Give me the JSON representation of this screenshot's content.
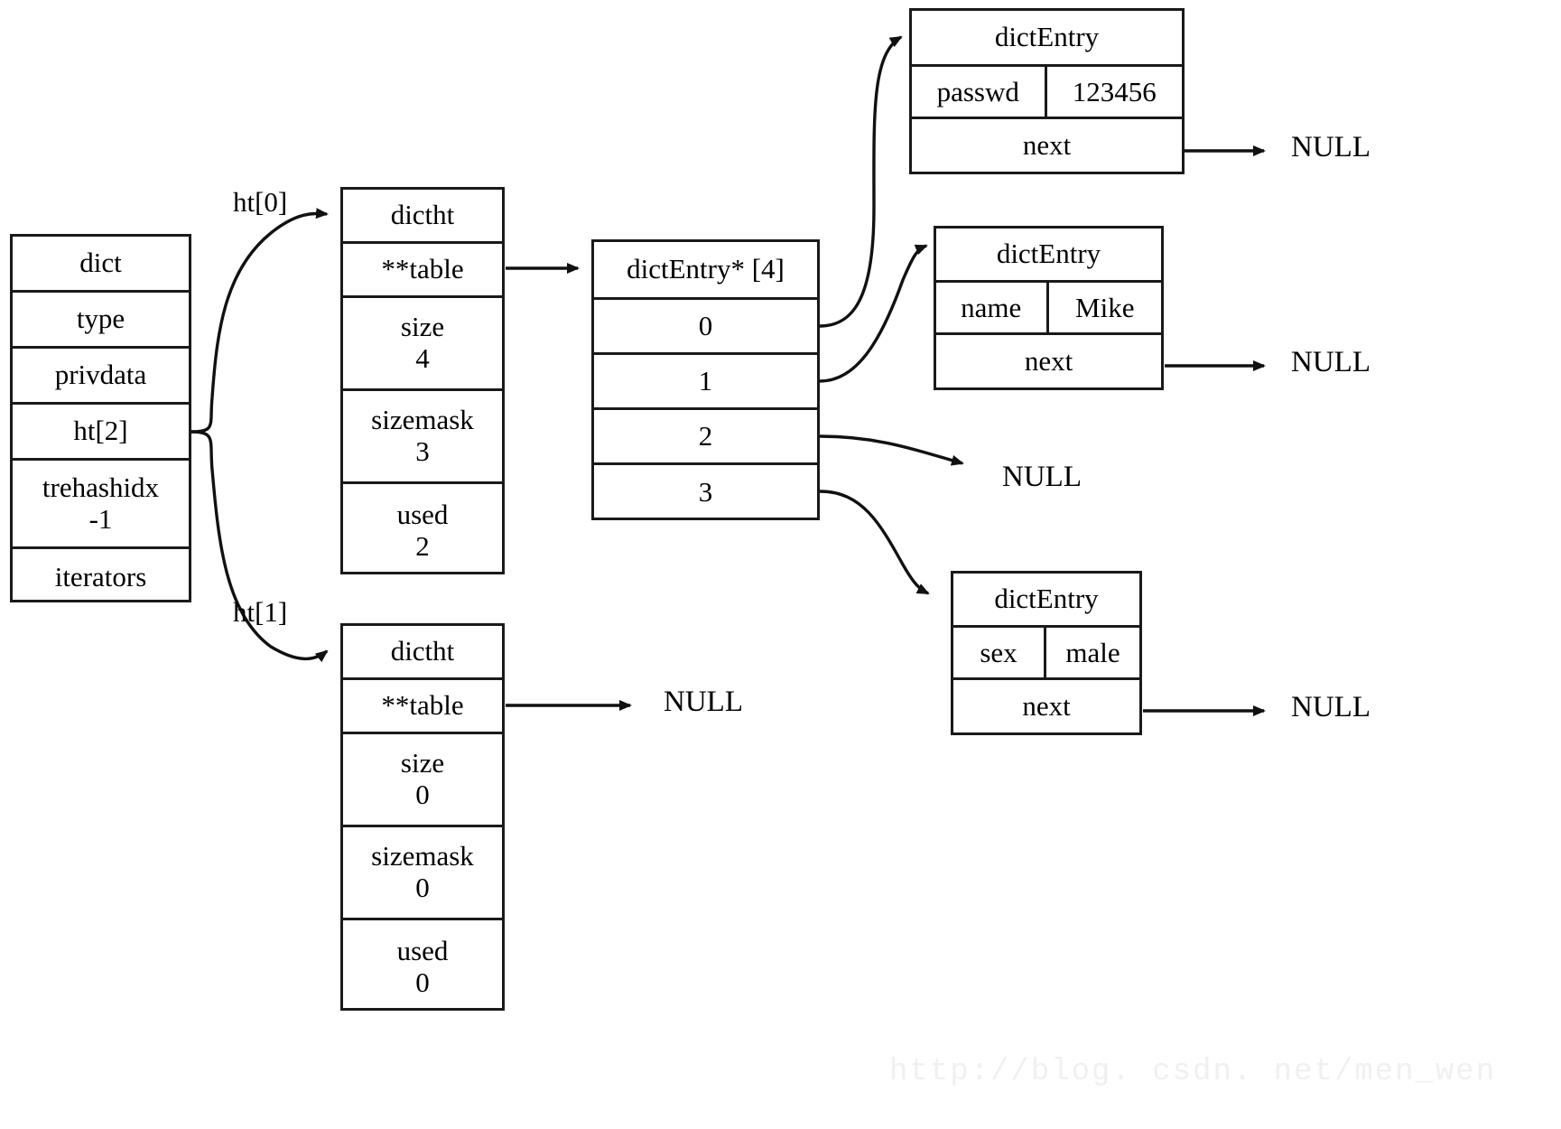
{
  "diagram": {
    "title": "Redis dict / dictht / dictEntry structure diagram",
    "watermark": "http://blog. csdn. net/men_wen",
    "null_labels": {
      "passwd_next": "NULL",
      "name_next": "NULL",
      "bucket2": "NULL",
      "sex_next": "NULL",
      "ht1_table": "NULL"
    },
    "edge_labels": {
      "ht0": "ht[0]",
      "ht1": "ht[1]"
    }
  },
  "dict": {
    "header": "dict",
    "fields": [
      {
        "label": "type"
      },
      {
        "label": "privdata"
      },
      {
        "label": "ht[2]"
      },
      {
        "label": "trehashidx",
        "value": "-1"
      },
      {
        "label": "iterators"
      }
    ]
  },
  "dictht0": {
    "header": "dictht",
    "fields": [
      {
        "label": "**table",
        "value": ""
      },
      {
        "label": "size",
        "value": "4"
      },
      {
        "label": "sizemask",
        "value": "3"
      },
      {
        "label": "used",
        "value": "2"
      }
    ]
  },
  "dictht1": {
    "header": "dictht",
    "fields": [
      {
        "label": "**table",
        "value": ""
      },
      {
        "label": "size",
        "value": "0"
      },
      {
        "label": "sizemask",
        "value": "0"
      },
      {
        "label": "used",
        "value": "0"
      }
    ]
  },
  "bucket_array": {
    "header": "dictEntry* [4]",
    "indices": [
      "0",
      "1",
      "2",
      "3"
    ]
  },
  "entries": [
    {
      "header": "dictEntry",
      "key": "passwd",
      "value": "123456",
      "next_label": "next",
      "next_value": "NULL"
    },
    {
      "header": "dictEntry",
      "key": "name",
      "value": "Mike",
      "next_label": "next",
      "next_value": "NULL"
    },
    {
      "header": "dictEntry",
      "key": "sex",
      "value": "male",
      "next_label": "next",
      "next_value": "NULL"
    }
  ]
}
